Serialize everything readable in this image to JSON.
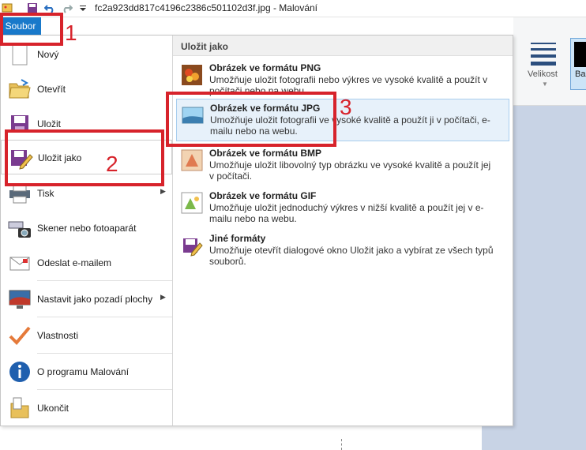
{
  "window": {
    "title": "fc2a923dd817c4196c2386c501102d3f.jpg - Malování"
  },
  "ribbon": {
    "file_tab": "Soubor",
    "size_label": "Velikost",
    "color_label": "Ba"
  },
  "menu": {
    "items": [
      {
        "label": "Nový",
        "icon": "new-document-icon"
      },
      {
        "label": "Otevřít",
        "icon": "open-folder-icon"
      },
      {
        "label": "Uložit",
        "icon": "save-disk-icon"
      },
      {
        "label": "Uložit jako",
        "icon": "save-as-icon"
      },
      {
        "label": "Tisk",
        "icon": "printer-icon"
      },
      {
        "label": "Skener nebo fotoaparát",
        "icon": "scanner-camera-icon"
      },
      {
        "label": "Odeslat e-mailem",
        "icon": "email-icon"
      },
      {
        "label": "Nastavit jako pozadí plochy",
        "icon": "desktop-background-icon"
      },
      {
        "label": "Vlastnosti",
        "icon": "checkmark-icon"
      },
      {
        "label": "O programu Malování",
        "icon": "info-icon"
      },
      {
        "label": "Ukončit",
        "icon": "exit-icon"
      }
    ]
  },
  "save_as": {
    "header": "Uložit jako",
    "options": [
      {
        "title": "Obrázek ve formátu PNG",
        "desc": "Umožňuje uložit fotografii nebo výkres ve vysoké kvalitě a použít v počítači nebo na webu.",
        "icon": "png-image-icon"
      },
      {
        "title": "Obrázek ve formátu JPG",
        "desc": "Umožňuje uložit fotografii ve vysoké kvalitě a použít ji v počítači, e-mailu nebo na webu.",
        "icon": "jpg-image-icon"
      },
      {
        "title": "Obrázek ve formátu BMP",
        "desc": "Umožňuje uložit libovolný typ obrázku ve vysoké kvalitě a použít jej v počítači.",
        "icon": "bmp-image-icon"
      },
      {
        "title": "Obrázek ve formátu GIF",
        "desc": "Umožňuje uložit jednoduchý výkres v nižší kvalitě a použít jej v e-mailu nebo na webu.",
        "icon": "gif-image-icon"
      },
      {
        "title": "Jiné formáty",
        "desc": "Umožňuje otevřít dialogové okno Uložit jako a vybírat ze všech typů souborů.",
        "icon": "other-formats-icon"
      }
    ]
  },
  "annotations": [
    "1",
    "2",
    "3"
  ],
  "colors": {
    "accent": "#1979ca",
    "annotation": "#d7232b",
    "highlight": "#e7f1fa",
    "canvas": "#c8d3e5"
  }
}
